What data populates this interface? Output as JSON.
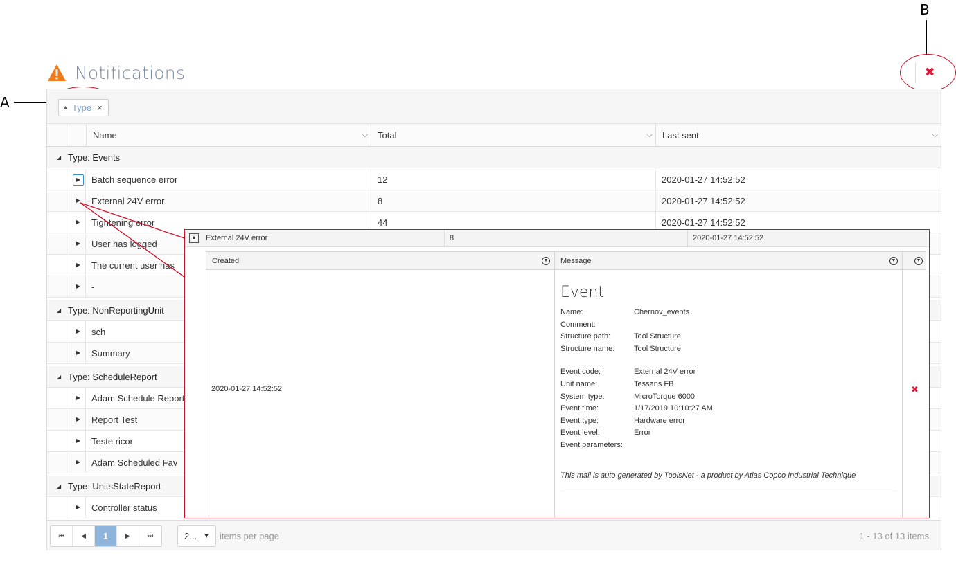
{
  "callouts": {
    "a": "A",
    "b": "B"
  },
  "header": {
    "title": "Notifications",
    "close_icon": "close-icon",
    "warning_color": "#f07b1d"
  },
  "group_panel": {
    "chip_label": "Type",
    "chip_remove": "×"
  },
  "columns": {
    "name": "Name",
    "total": "Total",
    "last_sent": "Last sent"
  },
  "groups": [
    {
      "label": "Type: Events",
      "rows": [
        {
          "name": "Batch sequence error",
          "total": "12",
          "last_sent": "2020-01-27 14:52:52"
        },
        {
          "name": "External 24V error",
          "total": "8",
          "last_sent": "2020-01-27 14:52:52"
        },
        {
          "name": "Tightening error",
          "total": "44",
          "last_sent": "2020-01-27 14:52:52"
        },
        {
          "name": "User has logged",
          "total": "",
          "last_sent": ""
        },
        {
          "name": "The current user has",
          "total": "",
          "last_sent": ""
        },
        {
          "name": "-",
          "total": "",
          "last_sent": ""
        }
      ]
    },
    {
      "label": "Type: NonReportingUnit",
      "rows": [
        {
          "name": "sch",
          "total": "",
          "last_sent": ""
        },
        {
          "name": "Summary",
          "total": "",
          "last_sent": ""
        }
      ]
    },
    {
      "label": "Type: ScheduleReport",
      "rows": [
        {
          "name": "Adam Schedule Report",
          "total": "",
          "last_sent": ""
        },
        {
          "name": "Report Test",
          "total": "",
          "last_sent": ""
        },
        {
          "name": "Teste ricor",
          "total": "",
          "last_sent": ""
        },
        {
          "name": "Adam Scheduled Fav",
          "total": "",
          "last_sent": ""
        }
      ]
    },
    {
      "label": "Type: UnitsStateReport",
      "rows": [
        {
          "name": "Controller status",
          "total": "",
          "last_sent": ""
        }
      ]
    }
  ],
  "pager": {
    "page": "1",
    "page_size": "2...",
    "items_per_page": "items per page",
    "info": "1 - 13 of 13 items"
  },
  "detail": {
    "row": {
      "name": "External 24V error",
      "total": "8",
      "last_sent": "2020-01-27 14:52:52"
    },
    "columns": {
      "created": "Created",
      "message": "Message"
    },
    "created_value": "2020-01-27 14:52:52",
    "event": {
      "title": "Event",
      "fields1": [
        {
          "k": "Name:",
          "v": "Chernov_events"
        },
        {
          "k": "Comment:",
          "v": ""
        },
        {
          "k": "Structure path:",
          "v": "Tool Structure"
        },
        {
          "k": "Structure name:",
          "v": "Tool Structure"
        }
      ],
      "fields2": [
        {
          "k": "Event code:",
          "v": "External 24V error"
        },
        {
          "k": "Unit name:",
          "v": "Tessans FB"
        },
        {
          "k": "System type:",
          "v": "MicroTorque 6000"
        },
        {
          "k": "Event time:",
          "v": "1/17/2019 10:10:27 AM"
        },
        {
          "k": "Event type:",
          "v": "Hardware error"
        },
        {
          "k": "Event level:",
          "v": "Error"
        },
        {
          "k": "Event parameters:",
          "v": ""
        }
      ],
      "footer": "This mail is auto generated by ToolsNet - a product by Atlas Copco Industrial Technique"
    }
  }
}
